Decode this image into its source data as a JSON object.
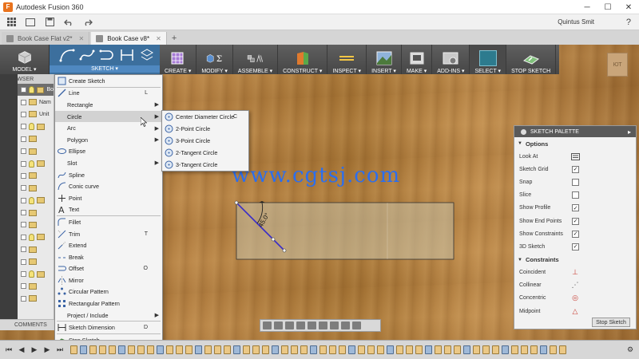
{
  "window": {
    "title": "Autodesk Fusion 360",
    "app_icon_letter": "F",
    "controls": [
      "─",
      "☐",
      "✕"
    ]
  },
  "qat": {
    "user": "Quintus Smit",
    "help_icon": "?"
  },
  "doc_tabs": [
    {
      "label": "Book Case Flat v2*",
      "active": false
    },
    {
      "label": "Book Case v8*",
      "active": true
    }
  ],
  "toolbar": {
    "model_label": "MODEL ▾",
    "sketch_label": "SKETCH ▾",
    "groups": [
      {
        "label": "CREATE ▾",
        "icon": "create-icon"
      },
      {
        "label": "MODIFY ▾",
        "icon": "modify-icon"
      },
      {
        "label": "ASSEMBLE ▾",
        "icon": "assemble-icon"
      },
      {
        "label": "CONSTRUCT ▾",
        "icon": "construct-icon"
      },
      {
        "label": "INSPECT ▾",
        "icon": "inspect-icon"
      },
      {
        "label": "INSERT ▾",
        "icon": "insert-icon"
      },
      {
        "label": "MAKE ▾",
        "icon": "make-icon"
      },
      {
        "label": "ADD-INS ▾",
        "icon": "addins-icon"
      },
      {
        "label": "SELECT ▾",
        "icon": "select-icon"
      },
      {
        "label": "STOP SKETCH",
        "icon": "stop-sketch-icon"
      }
    ]
  },
  "browser": {
    "header": "BROWSER",
    "rows": [
      "Bo",
      "Nam",
      "Unit",
      "",
      "",
      "",
      "",
      "",
      "",
      "",
      "",
      "",
      "",
      "",
      "",
      "",
      "",
      ""
    ],
    "comments": "COMMENTS"
  },
  "viewcube": {
    "label": "ЮТ"
  },
  "sketch_menu": {
    "items": [
      {
        "label": "Create Sketch",
        "shortcut": "",
        "submenu": false,
        "icon": "create-sketch-icon"
      },
      {
        "sep": true
      },
      {
        "label": "Line",
        "shortcut": "L",
        "submenu": false,
        "icon": "line-icon"
      },
      {
        "label": "Rectangle",
        "shortcut": "",
        "submenu": true,
        "icon": ""
      },
      {
        "label": "Circle",
        "shortcut": "",
        "submenu": true,
        "icon": "",
        "hover": true
      },
      {
        "label": "Arc",
        "shortcut": "",
        "submenu": true,
        "icon": ""
      },
      {
        "label": "Polygon",
        "shortcut": "",
        "submenu": true,
        "icon": ""
      },
      {
        "label": "Ellipse",
        "shortcut": "",
        "submenu": false,
        "icon": "ellipse-icon"
      },
      {
        "label": "Slot",
        "shortcut": "",
        "submenu": true,
        "icon": ""
      },
      {
        "label": "Spline",
        "shortcut": "",
        "submenu": false,
        "icon": "spline-icon"
      },
      {
        "label": "Conic curve",
        "shortcut": "",
        "submenu": false,
        "icon": "conic-curve-icon"
      },
      {
        "label": "Point",
        "shortcut": "",
        "submenu": false,
        "icon": "point-icon"
      },
      {
        "label": "Text",
        "shortcut": "",
        "submenu": false,
        "icon": "text-icon"
      },
      {
        "sep": true
      },
      {
        "label": "Fillet",
        "shortcut": "",
        "submenu": false,
        "icon": "fillet-icon"
      },
      {
        "label": "Trim",
        "shortcut": "T",
        "submenu": false,
        "icon": "trim-icon"
      },
      {
        "label": "Extend",
        "shortcut": "",
        "submenu": false,
        "icon": "extend-icon"
      },
      {
        "label": "Break",
        "shortcut": "",
        "submenu": false,
        "icon": "break-icon"
      },
      {
        "label": "Offset",
        "shortcut": "O",
        "submenu": false,
        "icon": "offset-icon"
      },
      {
        "label": "Mirror",
        "shortcut": "",
        "submenu": false,
        "icon": "mirror-icon"
      },
      {
        "label": "Circular Pattern",
        "shortcut": "",
        "submenu": false,
        "icon": "circular-pattern-icon"
      },
      {
        "label": "Rectangular Pattern",
        "shortcut": "",
        "submenu": false,
        "icon": "rectangular-pattern-icon"
      },
      {
        "label": "Project / Include",
        "shortcut": "",
        "submenu": true,
        "icon": ""
      },
      {
        "sep": true
      },
      {
        "label": "Sketch Dimension",
        "shortcut": "D",
        "submenu": false,
        "icon": "sketch-dimension-icon"
      },
      {
        "sep": true
      },
      {
        "label": "Stop Sketch",
        "shortcut": "",
        "submenu": false,
        "icon": "stop-sketch-icon"
      }
    ]
  },
  "circle_submenu": [
    {
      "label": "Center Diameter Circle",
      "shortcut": "C"
    },
    {
      "label": "2-Point Circle",
      "shortcut": ""
    },
    {
      "label": "3-Point Circle",
      "shortcut": ""
    },
    {
      "label": "2-Tangent Circle",
      "shortcut": ""
    },
    {
      "label": "3-Tangent Circle",
      "shortcut": ""
    }
  ],
  "watermark": "www.cgtsj.com",
  "sketch": {
    "angle_label": "45.0°"
  },
  "palette": {
    "title": "SKETCH PALETTE",
    "options_label": "Options",
    "options": [
      {
        "label": "Look At",
        "type": "icon",
        "checked": false
      },
      {
        "label": "Sketch Grid",
        "type": "check",
        "checked": true
      },
      {
        "label": "Snap",
        "type": "check",
        "checked": false
      },
      {
        "label": "Slice",
        "type": "check",
        "checked": false
      },
      {
        "label": "Show Profile",
        "type": "check",
        "checked": true
      },
      {
        "label": "Show End Points",
        "type": "check",
        "checked": true
      },
      {
        "label": "Show Constraints",
        "type": "check",
        "checked": true
      },
      {
        "label": "3D Sketch",
        "type": "check",
        "checked": true
      }
    ],
    "constraints_label": "Constraints",
    "constraints": [
      {
        "label": "Coincident",
        "glyph": "⊥"
      },
      {
        "label": "Collinear",
        "glyph": "⋰"
      },
      {
        "label": "Concentric",
        "glyph": "◎"
      },
      {
        "label": "Midpoint",
        "glyph": "△"
      }
    ],
    "stop_button": "Stop Sketch"
  },
  "colors": {
    "accent": "#3c6f9d",
    "sketch_line": "#3a2cc8",
    "watermark": "#2a6ef0"
  }
}
